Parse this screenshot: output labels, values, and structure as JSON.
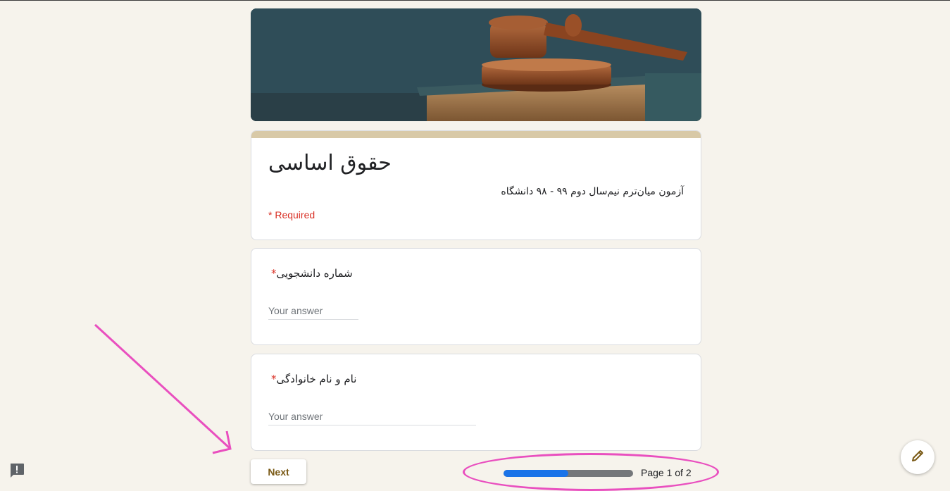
{
  "form": {
    "title": "حقوق اساسی",
    "description": "آزمون میان‌ترم نیم‌سال دوم ۹۹ - ۹۸ دانشگاه",
    "required_note": "* Required"
  },
  "questions": [
    {
      "label": "شماره دانشجویی",
      "required_mark": "*",
      "placeholder": "Your answer"
    },
    {
      "label": "نام و نام خانوادگی",
      "required_mark": "*",
      "placeholder": "Your answer"
    }
  ],
  "footer": {
    "next_label": "Next",
    "page_indicator": "Page 1 of 2",
    "progress_percent": 50
  },
  "icons": {
    "report": "report-problem-icon",
    "edit": "pencil-icon"
  },
  "colors": {
    "accent": "#d8c9a7",
    "required": "#d93025",
    "progress": "#1a73e8",
    "annotation": "#e94fbf"
  }
}
